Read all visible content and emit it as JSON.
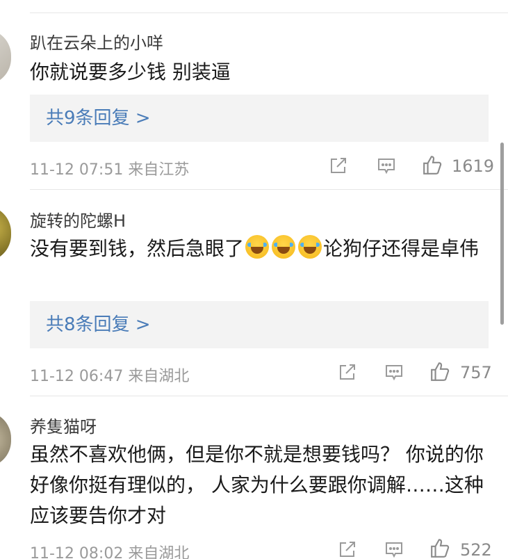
{
  "comments": [
    {
      "username": "趴在云朵上的小咩",
      "content": "你就说要多少钱 别装逼",
      "replies_label": "共9条回复 >",
      "timestamp": "11-12 07:51 来自江苏",
      "likes": "1619"
    },
    {
      "username": "旋转的陀螺H",
      "content_before": "没有要到钱，然后急眼了",
      "content_after": "论狗仔还得是卓伟",
      "emoji_name": "laughing-tears-emoji",
      "replies_label": "共8条回复 >",
      "timestamp": "11-12 06:47 来自湖北",
      "likes": "757"
    },
    {
      "username": "养隻猫呀",
      "content": "虽然不喜欢他俩，但是你不就是想要钱吗？ 你说的你好像你挺有理似的， 人家为什么要跟你调解……这种应该要告你才对",
      "timestamp": "11-12 08:02 来自湖北",
      "likes": "522"
    }
  ],
  "icons": {
    "share": "share-icon",
    "comment": "comment-icon",
    "like": "thumbs-up-icon"
  },
  "colors": {
    "reply_link": "#4a7cb8",
    "meta_text": "#9a9a9a",
    "reply_bg": "#f3f3f3"
  }
}
